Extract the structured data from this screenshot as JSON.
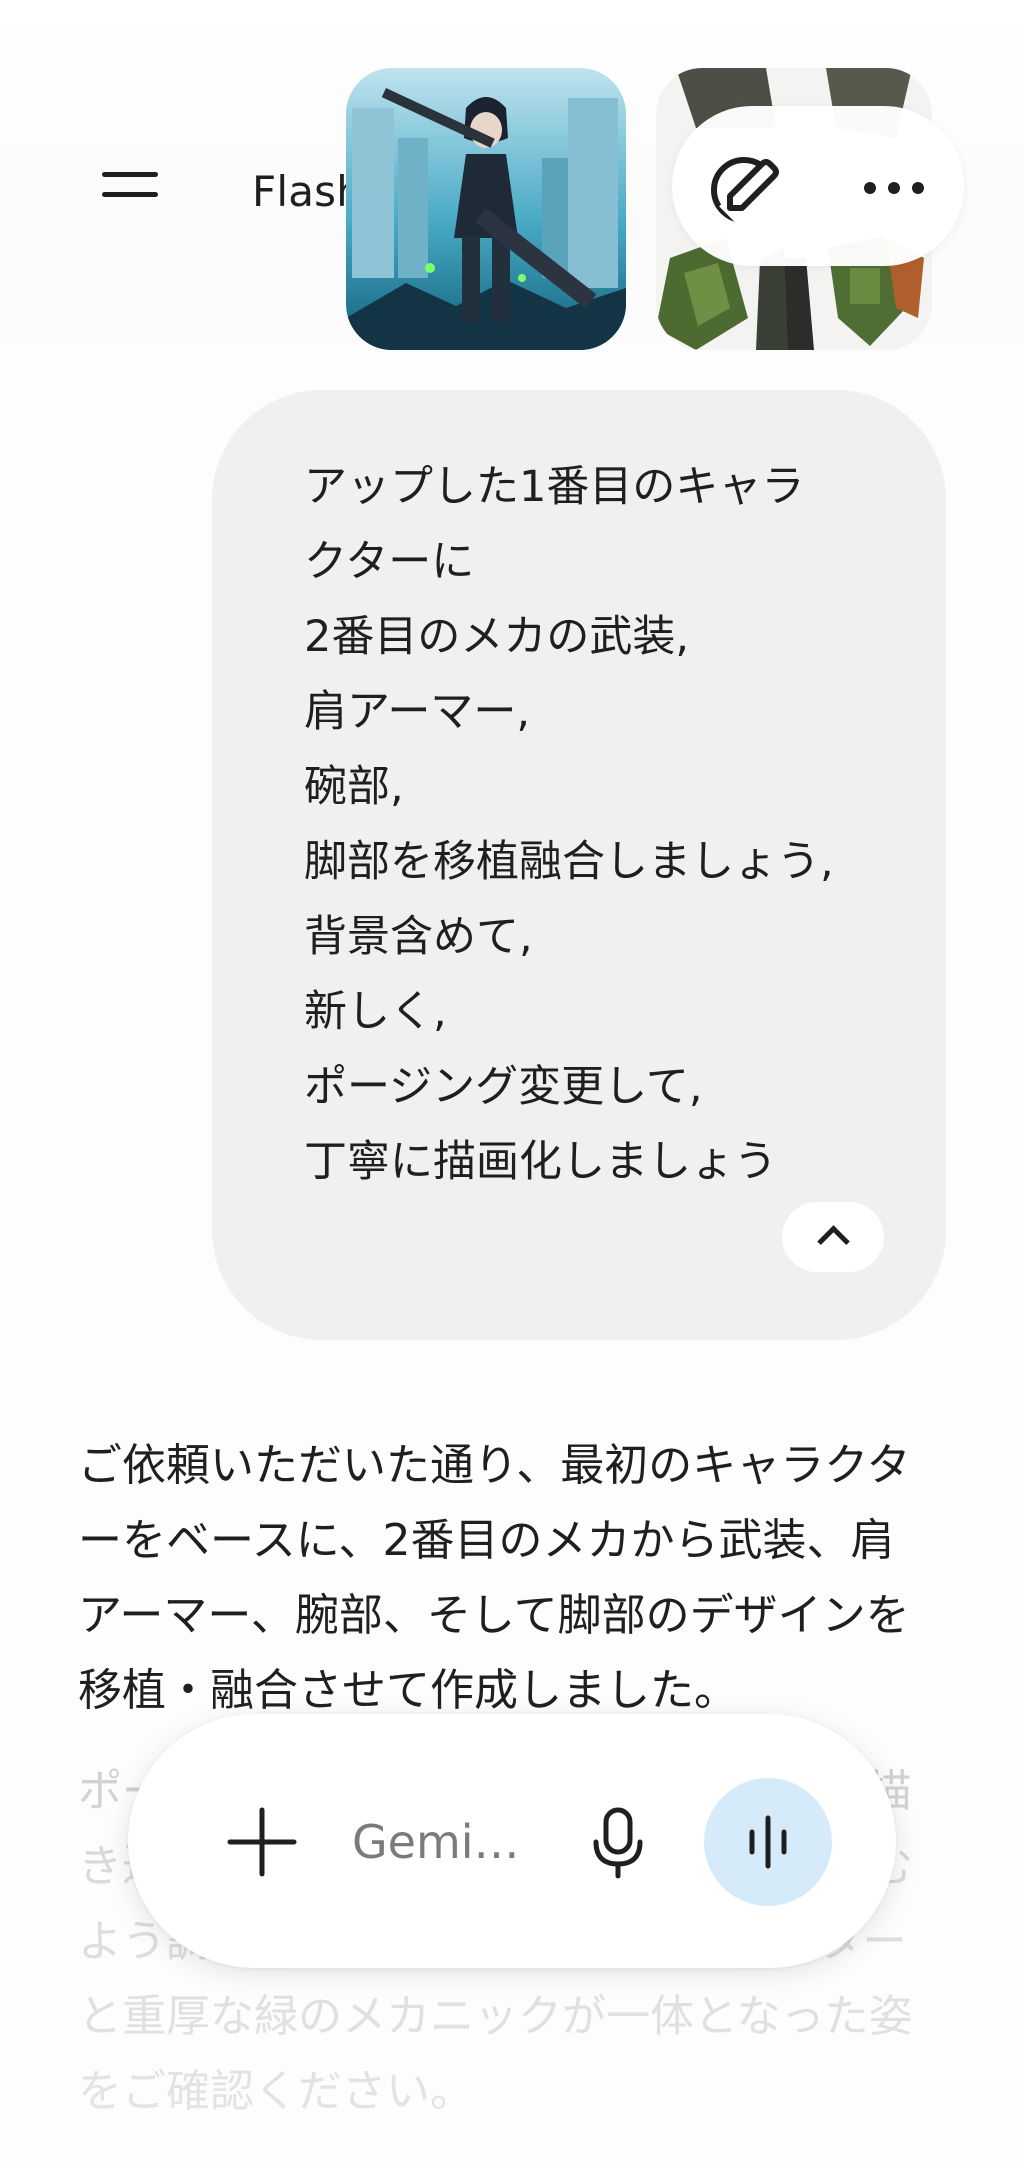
{
  "header": {
    "menu_icon": "hamburger-menu-icon",
    "model_label": "Flash 拡張",
    "model_chevron_icon": "chevron-down-icon",
    "edit_icon": "pencil-edit-icon",
    "more_icon": "more-horizontal-icon"
  },
  "attachments": [
    {
      "kind": "image",
      "subject": "character"
    },
    {
      "kind": "image",
      "subject": "mecha"
    }
  ],
  "user_message": {
    "text": "アップした1番目のキャラクターに\n2番目のメカの武装,\n肩アーマー,\n碗部,\n脚部を移植融合しましょう,\n背景含めて,\n新しく,\nポージング変更して,\n丁寧に描画化しましょう",
    "collapse_icon": "chevron-up-icon"
  },
  "response": {
    "paragraph_1": "ご依頼いただいた通り、最初のキャラクターをベースに、2番目のメカから武装、肩アーマー、腕部、そして脚部のデザインを移植・融合させて作成しました。",
    "paragraph_2": "ポーズを新しくし、背景も含めて丁寧に描き込み、各部のメカパーツが自然に馴染むよう調整しています。黒髪のキャラクターと重厚な緑のメカニックが一体となった姿をご確認ください。"
  },
  "input_bar": {
    "add_icon": "plus-icon",
    "placeholder": "Gemi…",
    "mic_icon": "microphone-icon",
    "live_icon": "live-voice-icon",
    "live_color": "#d6ebfa"
  }
}
